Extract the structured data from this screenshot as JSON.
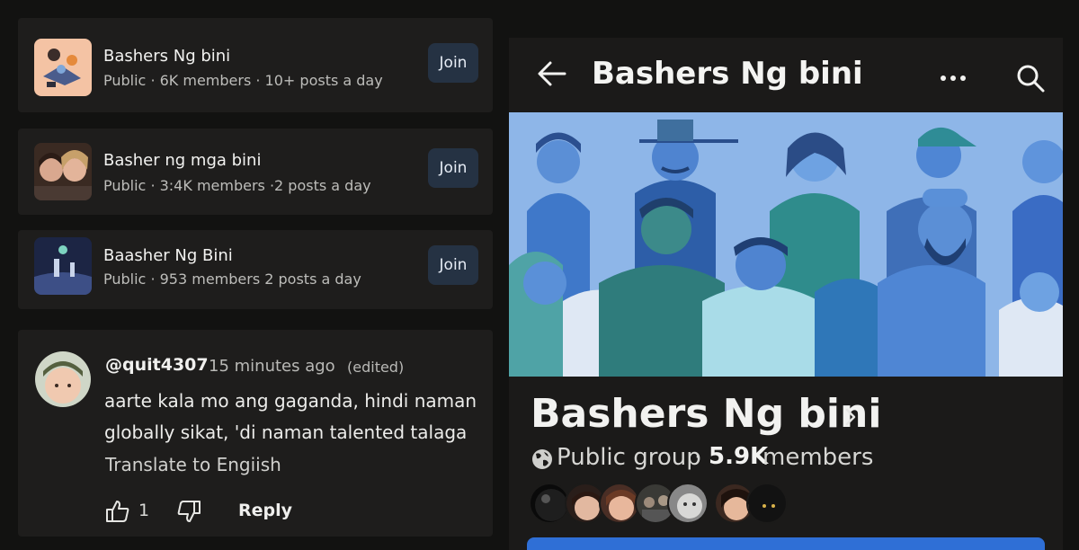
{
  "suggested_groups": [
    {
      "name": "Bashers Ng bini",
      "meta": "Public · 6K members · 10+ posts a day",
      "join_label": "Join"
    },
    {
      "name": "Basher ng mga bini",
      "meta": "Public · 3:4K members ·2 posts a day",
      "join_label": "Join"
    },
    {
      "name": "Baasher Ng Bini",
      "meta": "Public · 953 members 2 posts a day",
      "join_label": "Join"
    }
  ],
  "comment": {
    "username": "@quit4307",
    "time": "15 minutes ago",
    "edited": "(edited)",
    "text": "aarte kala mo ang gaganda, hindi naman globally sikat, 'di naman talented talaga",
    "translate": "Translate to Engiish",
    "like_count": "1",
    "reply_label": "Reply"
  },
  "group_page": {
    "header_title": "Bashers Ng bini",
    "title": "Bashers Ng bini",
    "privacy": "Public group",
    "separator": "·",
    "member_count": "5.9K",
    "member_label": "members"
  },
  "colors": {
    "background": "#121211",
    "card": "#1e1d1c",
    "join_button": "#253243",
    "cover": "#8db4e6",
    "primary_button": "#2f6fd6"
  },
  "icons": [
    "back-arrow-icon",
    "more-dots-icon",
    "search-icon",
    "chevron-right-icon",
    "globe-icon",
    "thumbs-up-icon",
    "thumbs-down-icon"
  ]
}
